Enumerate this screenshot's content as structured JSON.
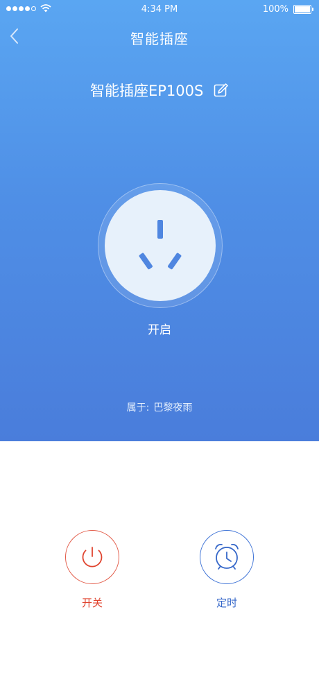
{
  "status_bar": {
    "time": "4:34 PM",
    "battery": "100%",
    "signal_icon": "signal-dots-icon",
    "wifi_icon": "wifi-icon"
  },
  "nav": {
    "title": "智能插座",
    "back_icon": "chevron-left-icon"
  },
  "device": {
    "name": "智能插座EP100S",
    "edit_icon": "edit-pencil-icon"
  },
  "socket": {
    "state_label": "开启"
  },
  "owner": {
    "label": "属于:",
    "name": "巴黎夜雨"
  },
  "actions": {
    "power": {
      "label": "开关",
      "color": "#e0442f",
      "icon": "power-icon"
    },
    "timer": {
      "label": "定时",
      "color": "#3567c9",
      "icon": "alarm-clock-icon"
    }
  },
  "colors": {
    "gradient_top": "#5aa6f2",
    "gradient_bottom": "#4a7ddb",
    "socket_face": "#e7f1fb",
    "socket_slot": "#4f86e0"
  }
}
